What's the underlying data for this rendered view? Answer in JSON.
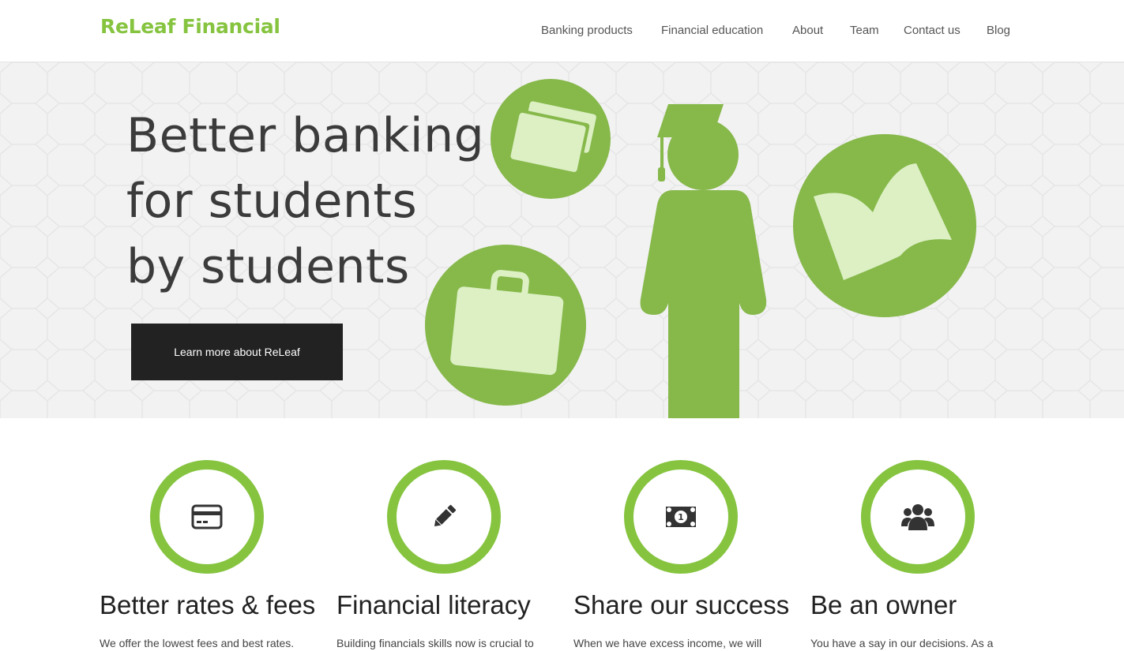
{
  "brand": {
    "logo_text": "ReLeaf Financial",
    "accent_color": "#86c440"
  },
  "nav": {
    "items": [
      {
        "label": "Banking products"
      },
      {
        "label": "Financial education"
      },
      {
        "label": "About"
      },
      {
        "label": "Team"
      },
      {
        "label": "Contact us"
      },
      {
        "label": "Blog"
      }
    ]
  },
  "hero": {
    "headline_lines": [
      "Better banking",
      "for students",
      "by students"
    ],
    "cta_label": "Learn more about ReLeaf",
    "illustrations": [
      "credit-cards-icon",
      "briefcase-icon",
      "graduate-icon",
      "open-book-icon"
    ]
  },
  "features": [
    {
      "icon": "credit-card-icon",
      "title": "Better rates & fees",
      "text": "We offer the lowest fees and best rates."
    },
    {
      "icon": "pencil-icon",
      "title": "Financial literacy",
      "text": "Building financials skills now is crucial to"
    },
    {
      "icon": "dollar-bill-icon",
      "title": "Share our success",
      "text": "When we have excess income, we will"
    },
    {
      "icon": "users-icon",
      "title": "Be an owner",
      "text": "You have a say in our decisions. As a"
    }
  ]
}
